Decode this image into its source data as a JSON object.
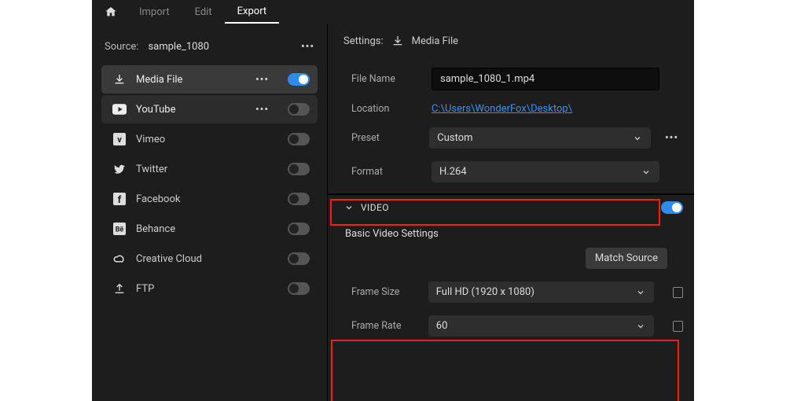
{
  "tabs": {
    "import": "Import",
    "edit": "Edit",
    "export": "Export"
  },
  "source": {
    "label": "Source:",
    "value": "sample_1080"
  },
  "destinations": [
    {
      "label": "Media File"
    },
    {
      "label": "YouTube"
    },
    {
      "label": "Vimeo"
    },
    {
      "label": "Twitter"
    },
    {
      "label": "Facebook"
    },
    {
      "label": "Behance"
    },
    {
      "label": "Creative Cloud"
    },
    {
      "label": "FTP"
    }
  ],
  "settings": {
    "label": "Settings:",
    "destination": "Media File",
    "filename_label": "File Name",
    "filename": "sample_1080_1.mp4",
    "location_label": "Location",
    "location": "C:\\Users\\WonderFox\\Desktop\\",
    "preset_label": "Preset",
    "preset": "Custom",
    "format_label": "Format",
    "format": "H.264"
  },
  "video": {
    "header": "VIDEO",
    "subheading": "Basic Video Settings",
    "match_source": "Match Source",
    "frame_size_label": "Frame Size",
    "frame_size": "Full HD (1920 x 1080)",
    "frame_rate_label": "Frame Rate",
    "frame_rate": "60"
  }
}
